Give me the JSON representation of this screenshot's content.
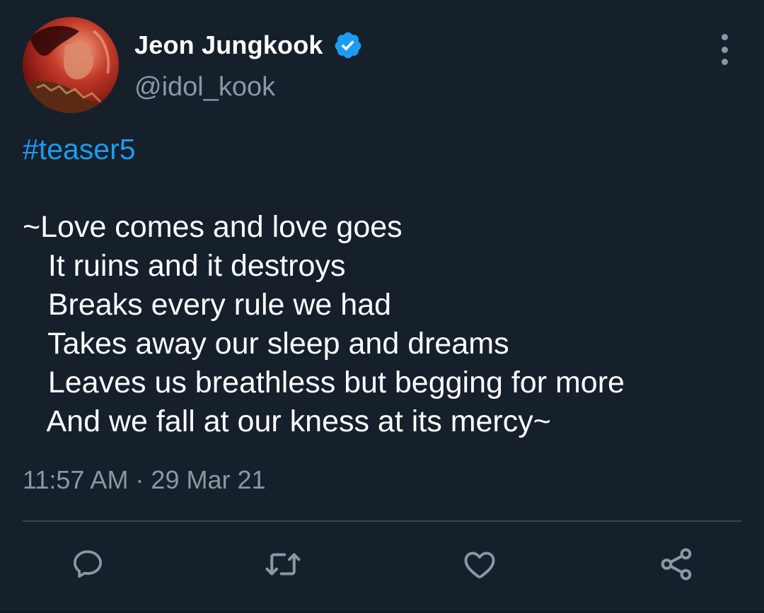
{
  "author": {
    "display_name": "Jeon Jungkook",
    "handle": "@idol_kook",
    "verified": true
  },
  "tweet": {
    "hashtag": "#teaser5",
    "body": "~Love comes and love goes\n   It ruins and it destroys\n   Breaks every rule we had\n   Takes away our sleep and dreams\n   Leaves us breathless but begging for more\n   And we fall at our kness at its mercy~",
    "timestamp": "11:57 AM · 29 Mar 21"
  },
  "actions": [
    {
      "name": "reply",
      "icon": "reply-icon"
    },
    {
      "name": "retweet",
      "icon": "retweet-icon"
    },
    {
      "name": "like",
      "icon": "heart-icon"
    },
    {
      "name": "share",
      "icon": "share-icon"
    }
  ],
  "colors": {
    "background": "#15202b",
    "accent": "#1d9bf0",
    "secondary_text": "#8899a6",
    "divider": "#38444d"
  }
}
